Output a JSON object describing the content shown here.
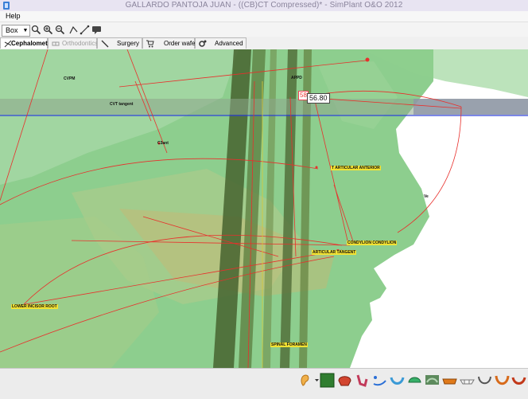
{
  "window": {
    "title": "GALLARDO PANTOJA JUAN -  ((CB)CT Compressed)* - SimPlant O&O 2012"
  },
  "menu": {
    "items": [
      "Help"
    ]
  },
  "toolbar": {
    "select_value": "Box",
    "icons": [
      "zoom-icon",
      "zoom-in-icon",
      "zoom-out-icon",
      "measure-angle-icon",
      "measure-distance-icon",
      "annotation-icon"
    ]
  },
  "tabs": [
    {
      "label": "Cephalometry",
      "state": "active",
      "icon": "cephalometry-icon"
    },
    {
      "label": "Orthodontics",
      "state": "disabled",
      "icon": "orthodontics-icon"
    },
    {
      "label": "Surgery",
      "state": "normal",
      "icon": "scalpel-icon"
    },
    {
      "label": "Order wafer",
      "state": "normal",
      "icon": "cart-icon"
    },
    {
      "label": "Advanced",
      "state": "normal",
      "icon": "gears-icon"
    }
  ],
  "measurements": {
    "partial_label": "58",
    "value_label": "56.80"
  },
  "landmarks": [
    "CVPM",
    "CVT tangent",
    "C3ant",
    "APPD",
    "Ve",
    "T ARTICULAR ANTERIOR",
    "CONDYLION CONDYLION",
    "ARTICULAR TANGENT",
    "LOWER INCISOR ROOT",
    "SPINAL FORAMEN"
  ],
  "bottom_tools": [
    "ear-icon",
    "color-swatch-icon",
    "skull-icon",
    "mandible-icon",
    "nerve-icon",
    "lower-arch-icon",
    "upper-arch-icon",
    "maxilla-icon",
    "dentition-icon",
    "crown-icon",
    "arch-outline-icon",
    "splint-icon",
    "jaw-icon"
  ],
  "colors": {
    "soft_tissue": "#5bbf5b",
    "measurement_line": "#e8302c",
    "selection_line": "#2c3fd8"
  }
}
